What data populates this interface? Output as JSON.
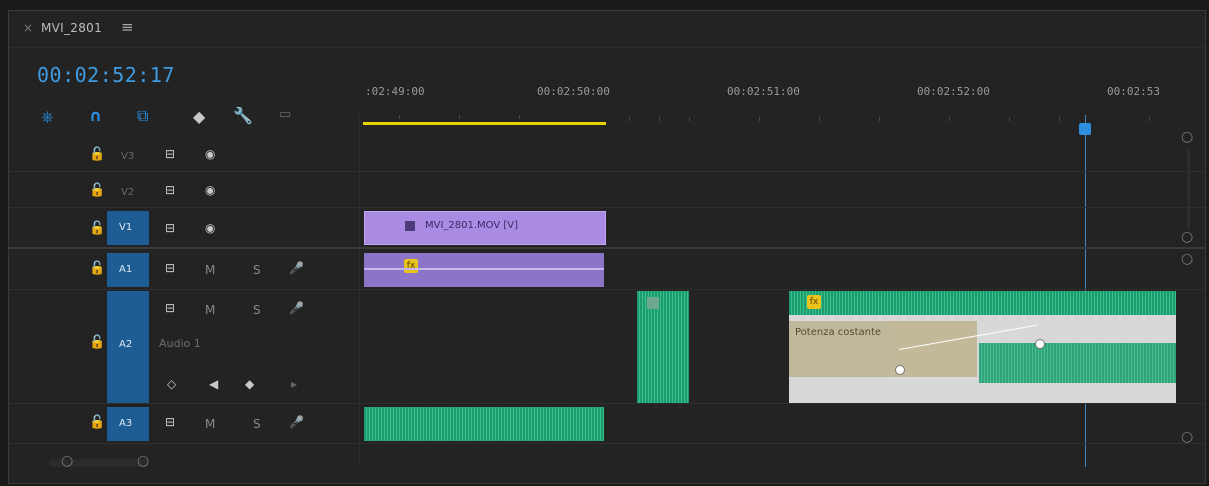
{
  "sequence": {
    "close_icon": "close-icon",
    "title": "MVI_2801",
    "menu_icon": "hamburger-menu-icon",
    "timecode": "00:02:52:17"
  },
  "toolbar": {
    "icons": [
      "snap-icon",
      "magnet-icon",
      "linked-selection-icon",
      "marker-icon",
      "wrench-icon",
      "captions-icon"
    ]
  },
  "ruler": {
    "labels": [
      ":02:49:00",
      "00:02:50:00",
      "00:02:51:00",
      "00:02:52:00",
      "00:02:53"
    ]
  },
  "tracks": {
    "v3": {
      "name": "V3"
    },
    "v2": {
      "name": "V2"
    },
    "v1": {
      "name": "V1",
      "target": "V1"
    },
    "a1": {
      "name": "A1",
      "target": "A1",
      "m": "M",
      "s": "S"
    },
    "a2": {
      "name": "A2",
      "target": "A2",
      "m": "M",
      "s": "S",
      "label": "Audio 1"
    },
    "a3": {
      "name": "A3",
      "target": "A3",
      "m": "M",
      "s": "S"
    }
  },
  "clips": {
    "video_clip_label": "MVI_2801.MOV [V]",
    "crossfade_label": "Potenza costante",
    "fx_label": "fx"
  },
  "colors": {
    "accent": "#2b8ee0",
    "video_clip": "#a98be3",
    "audio_clip": "#2b8f6c",
    "workarea": "#e6d200"
  }
}
